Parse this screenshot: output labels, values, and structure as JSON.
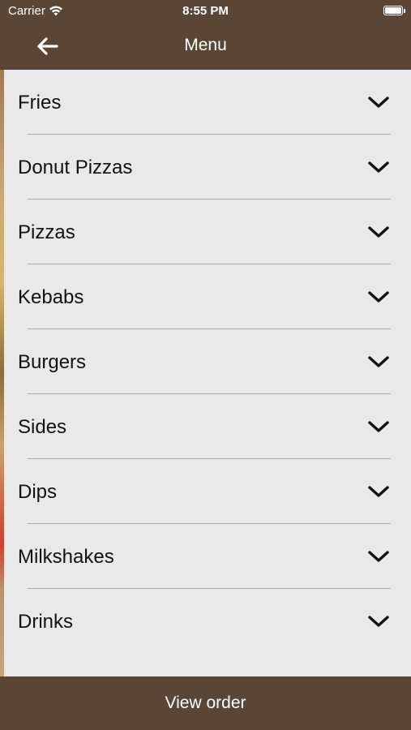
{
  "status_bar": {
    "carrier": "Carrier",
    "time": "8:55 PM",
    "wifi_icon": "wifi-icon",
    "battery_icon": "battery-icon"
  },
  "nav": {
    "title": "Menu",
    "back_icon": "arrow-left-icon"
  },
  "categories": [
    {
      "label": "Fries"
    },
    {
      "label": "Donut Pizzas"
    },
    {
      "label": "Pizzas"
    },
    {
      "label": "Kebabs"
    },
    {
      "label": "Burgers"
    },
    {
      "label": "Sides"
    },
    {
      "label": "Dips"
    },
    {
      "label": "Milkshakes"
    },
    {
      "label": "Drinks"
    }
  ],
  "footer": {
    "view_order_label": "View order"
  },
  "colors": {
    "bar_brown": "#5b4636",
    "list_background": "#e9e9e9",
    "divider": "#a9a9a9"
  }
}
